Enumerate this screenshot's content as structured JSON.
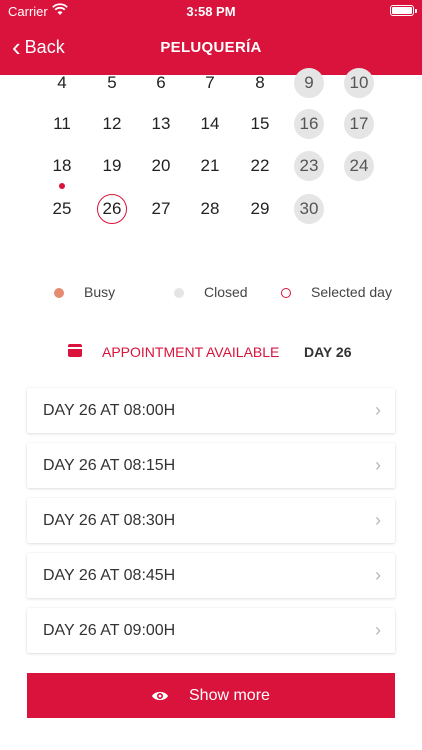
{
  "status_bar": {
    "carrier": "Carrier",
    "time": "3:58 PM"
  },
  "nav": {
    "back_label": "Back",
    "title": "PELUQUERÍA"
  },
  "calendar": {
    "rows": [
      [
        {
          "n": "4"
        },
        {
          "n": "5"
        },
        {
          "n": "6"
        },
        {
          "n": "7"
        },
        {
          "n": "8"
        },
        {
          "n": "9",
          "closed": true
        },
        {
          "n": "10",
          "closed": true
        }
      ],
      [
        {
          "n": "11"
        },
        {
          "n": "12"
        },
        {
          "n": "13"
        },
        {
          "n": "14"
        },
        {
          "n": "15"
        },
        {
          "n": "16",
          "closed": true
        },
        {
          "n": "17",
          "closed": true
        }
      ],
      [
        {
          "n": "18",
          "busy": true
        },
        {
          "n": "19"
        },
        {
          "n": "20"
        },
        {
          "n": "21"
        },
        {
          "n": "22"
        },
        {
          "n": "23",
          "closed": true
        },
        {
          "n": "24",
          "closed": true
        }
      ],
      [
        {
          "n": "25"
        },
        {
          "n": "26",
          "selected": true
        },
        {
          "n": "27"
        },
        {
          "n": "28"
        },
        {
          "n": "29"
        },
        {
          "n": "30",
          "closed": true
        }
      ]
    ]
  },
  "legend": {
    "busy": "Busy",
    "closed": "Closed",
    "selected": "Selected day"
  },
  "availability": {
    "label": "APPOINTMENT AVAILABLE",
    "day": "DAY 26"
  },
  "slots": [
    "DAY 26 AT 08:00H",
    "DAY 26 AT 08:15H",
    "DAY 26 AT 08:30H",
    "DAY 26 AT 08:45H",
    "DAY 26 AT 09:00H"
  ],
  "show_more": "Show more",
  "colors": {
    "accent": "#d9133b",
    "busy_dot": "#e58c70",
    "closed_fill": "#e5e5e5"
  }
}
